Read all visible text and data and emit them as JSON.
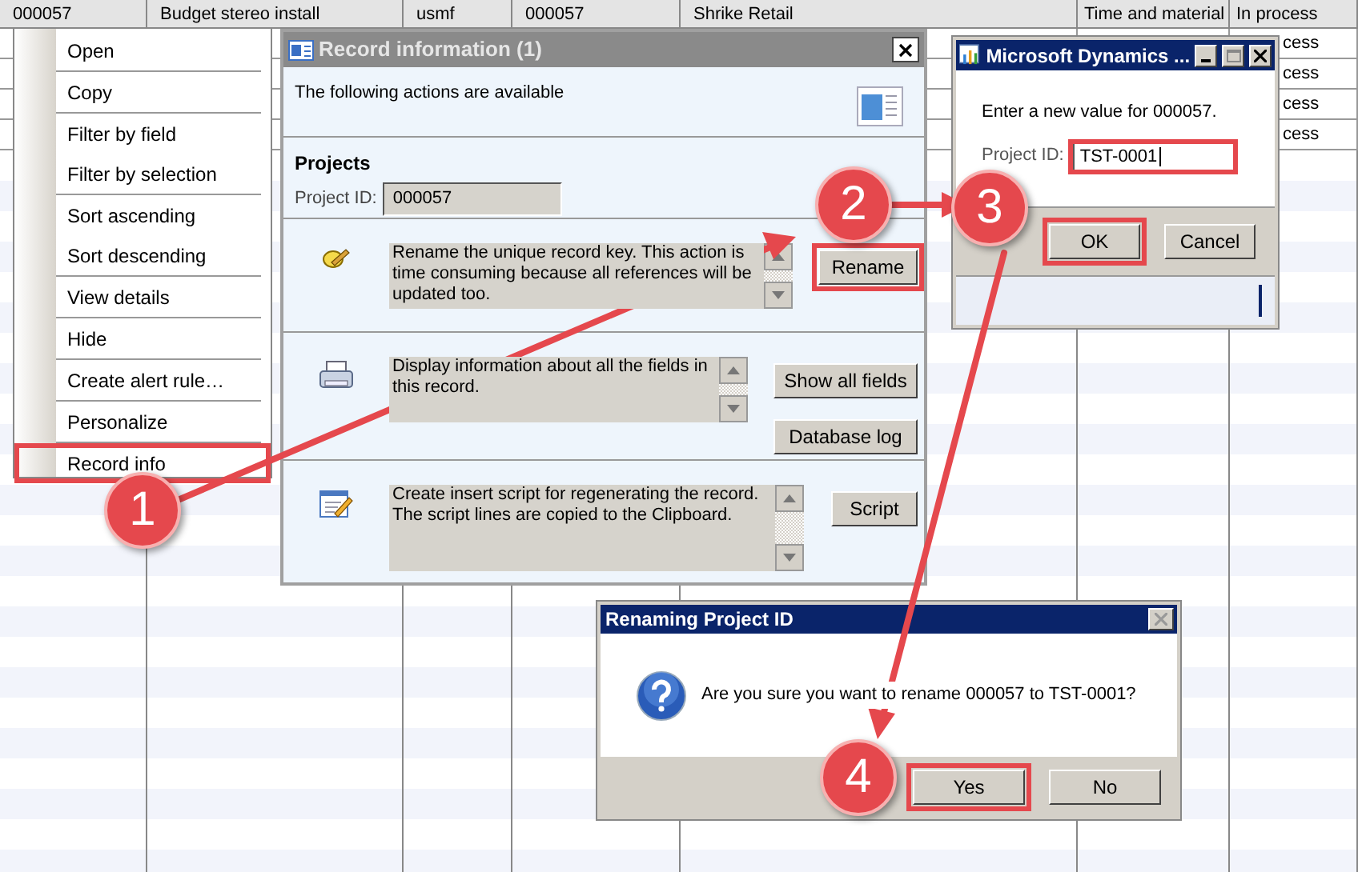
{
  "table": {
    "selected_row": [
      "000057",
      "Budget stereo install",
      "usmf",
      "000057",
      "Shrike Retail",
      "Time and material",
      "In process"
    ],
    "rows": [
      {
        "status": "cess"
      },
      {
        "status": "cess"
      },
      {
        "status": "cess"
      },
      {
        "status": "cess"
      }
    ]
  },
  "context_menu": {
    "groups": [
      [
        {
          "label": "Open",
          "highlighted": false
        }
      ],
      [
        {
          "label": "Copy",
          "highlighted": false
        }
      ],
      [
        {
          "label": "Filter by field",
          "highlighted": false
        },
        {
          "label": "Filter by selection",
          "highlighted": false
        }
      ],
      [
        {
          "label": "Sort ascending",
          "highlighted": false
        },
        {
          "label": "Sort descending",
          "highlighted": false
        }
      ],
      [
        {
          "label": "View details",
          "highlighted": false
        }
      ],
      [
        {
          "label": "Hide",
          "highlighted": false
        }
      ],
      [
        {
          "label": "Create alert rule…",
          "highlighted": false
        }
      ],
      [
        {
          "label": "Personalize",
          "highlighted": false
        }
      ],
      [
        {
          "label": "Record info",
          "highlighted": true
        }
      ]
    ]
  },
  "record_dialog": {
    "title": "Record information (1)",
    "intro": "The following actions are available",
    "section": "Projects",
    "field_label": "Project ID:",
    "field_value": "000057",
    "actions": [
      {
        "kind": "rename",
        "description": "Rename the unique record key. This action is time consuming because all references will be updated too.",
        "buttons": [
          {
            "label": "Rename",
            "highlighted": true
          }
        ]
      },
      {
        "kind": "info",
        "description": "Display information about all the fields in this record.",
        "buttons": [
          {
            "label": "Show all fields",
            "highlighted": false
          },
          {
            "label": "Database log",
            "highlighted": false
          }
        ]
      },
      {
        "kind": "script",
        "description": "Create insert script for regenerating the record. The script lines are copied to the Clipboard.",
        "buttons": [
          {
            "label": "Script",
            "highlighted": false
          }
        ]
      }
    ]
  },
  "rename_dialog": {
    "title": "Microsoft Dynamics ...",
    "prompt": "Enter a new value for 000057.",
    "field_label": "Project ID:",
    "field_value": "TST-0001",
    "field_highlighted": true,
    "buttons": [
      {
        "label": "OK",
        "highlighted": true
      },
      {
        "label": "Cancel",
        "highlighted": false
      }
    ]
  },
  "confirm_dialog": {
    "title": "Renaming Project ID",
    "message": "Are you sure you want to rename 000057 to TST-0001?",
    "buttons": [
      {
        "label": "Yes",
        "highlighted": true
      },
      {
        "label": "No",
        "highlighted": false
      }
    ]
  },
  "steps": [
    "1",
    "2",
    "3",
    "4"
  ]
}
